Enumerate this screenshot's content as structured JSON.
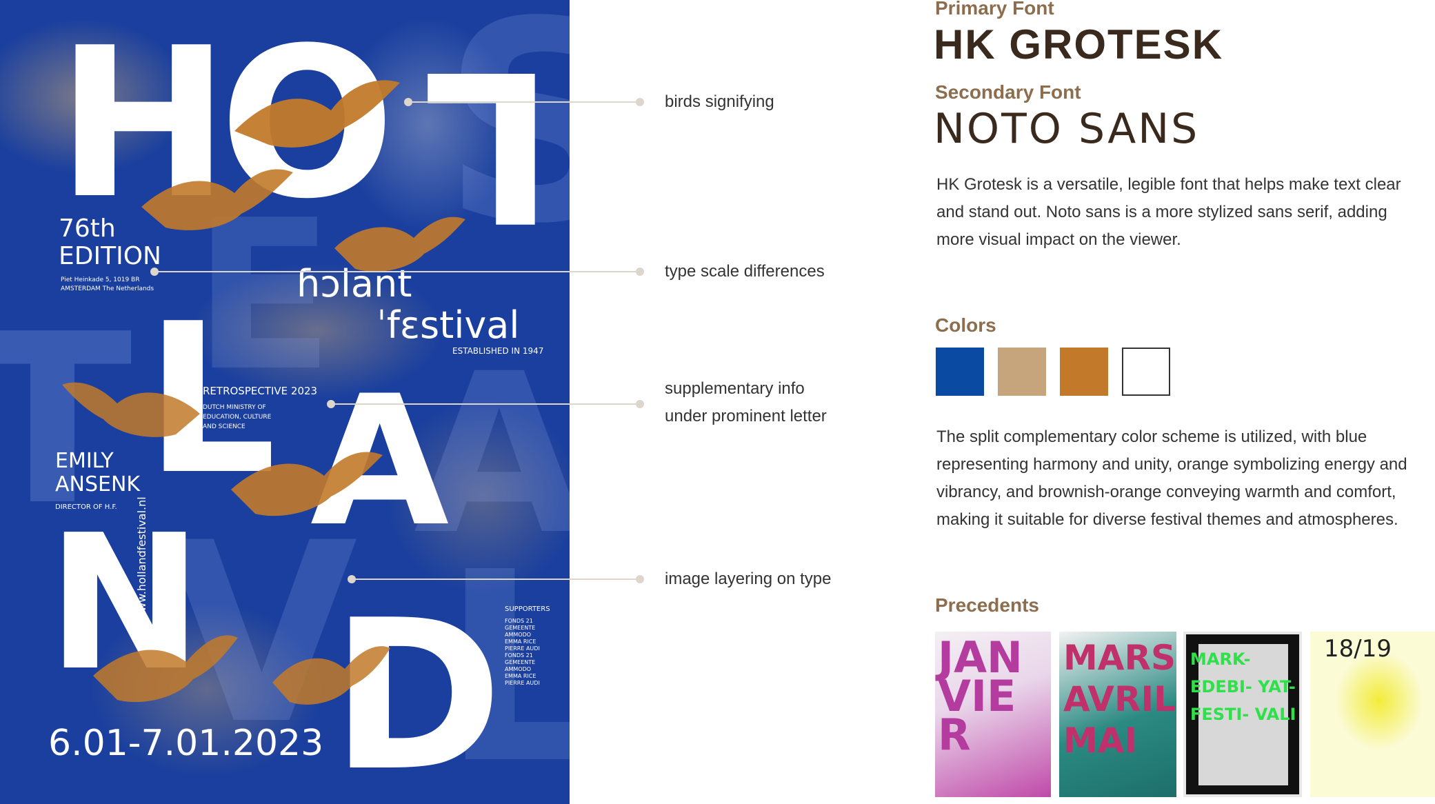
{
  "poster": {
    "letters": [
      "H",
      "O",
      "L",
      "L",
      "A",
      "N",
      "D"
    ],
    "edition": "76th\nEDITION",
    "address": "Piet Heinkade 5, 1019 BR\nAMSTERDAM The Netherlands",
    "holland_word": "ɦɔlant",
    "festival_word": "ˈfɛstival",
    "established": "ESTABLISHED IN 1947",
    "retrospective": "RETROSPECTIVE 2023",
    "ministry": "DUTCH MINISTRY OF\nEDUCATION, CULTURE\nAND SCIENCE",
    "person_name": "EMILY\nANSENK",
    "person_role": "DIRECTOR OF H.F.",
    "website": "www.hollandfestival.nl",
    "supporters_title": "SUPPORTERS",
    "supporters_list": "FONDS 21\nGEMEENTE\nAMMODO\nEMMA RICE\nPIERRE AUDI\nFONDS 21\nGEMEENTE\nAMMODO\nEMMA RICE\nPIERRE AUDI",
    "dates": "6.01-7.01.2023"
  },
  "callouts": [
    "birds signifying",
    "type scale differences",
    "supplementary info\nunder prominent letter",
    "image layering on type"
  ],
  "fonts": {
    "primary_label": "Primary Font",
    "primary_name": "HK GROTESK",
    "secondary_label": "Secondary Font",
    "secondary_name": "NOTO SANS",
    "description": "HK Grotesk is a versatile, legible font that helps make text clear and stand out. Noto sans is a more stylized sans serif, adding more visual impact on the viewer."
  },
  "colors": {
    "label": "Colors",
    "swatches": [
      "#0a4aa3",
      "#c6a57d",
      "#c27a2a",
      "#ffffff"
    ],
    "description": "The split complementary color scheme is utilized, with blue representing harmony and unity, orange symbolizing energy and vibrancy, and brownish-orange conveying warmth and comfort, making it suitable for diverse festival themes and atmospheres."
  },
  "precedents": {
    "label": "Precedents",
    "thumb1_text": "JANVIER",
    "thumb2_text": "MARS AVRIL MAI",
    "thumb3_text": "MARK- EDEBI- YAT- FESTI- VALI",
    "thumb4_text": "18/19"
  }
}
